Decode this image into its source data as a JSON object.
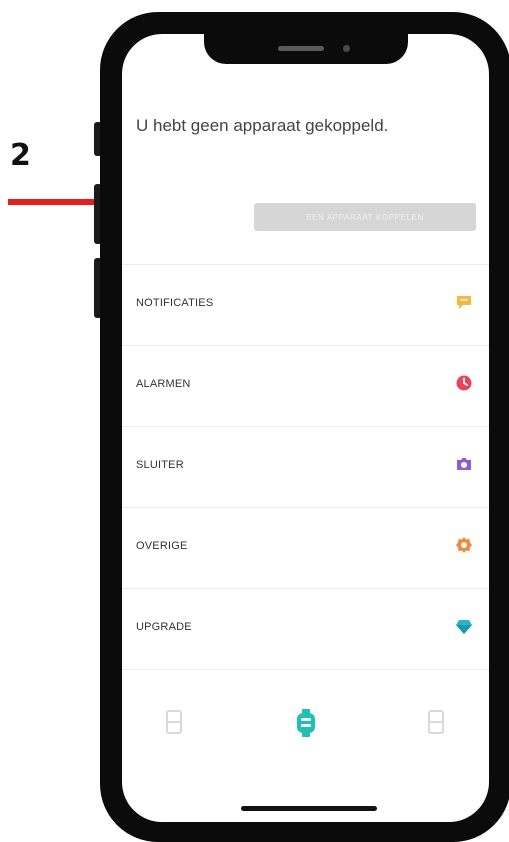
{
  "annotation": {
    "step_number": "2",
    "arrow_color": "#e61e1e"
  },
  "screen": {
    "headline": "U hebt geen apparaat gekoppeld.",
    "connect_button_label": "EEN APPARAAT KOPPELEN"
  },
  "menu": {
    "items": [
      {
        "label": "NOTIFICATIES",
        "icon": "chat-bubble-icon",
        "color": "#f5b942"
      },
      {
        "label": "ALARMEN",
        "icon": "clock-icon",
        "color": "#e8455b"
      },
      {
        "label": "SLUITER",
        "icon": "camera-icon",
        "color": "#8f5cd6"
      },
      {
        "label": "OVERIGE",
        "icon": "gear-icon",
        "color": "#f08a3a"
      },
      {
        "label": "UPGRADE",
        "icon": "diamond-icon",
        "color": "#2bb3c8"
      }
    ]
  },
  "tabbar": {
    "tabs": [
      {
        "name": "left-device",
        "icon": "device-outline-icon",
        "color": "#d9d9d9"
      },
      {
        "name": "center-watch",
        "icon": "watch-icon",
        "color": "#1fc1b7",
        "active": true
      },
      {
        "name": "right-device",
        "icon": "device-outline-icon",
        "color": "#d9d9d9"
      }
    ]
  }
}
